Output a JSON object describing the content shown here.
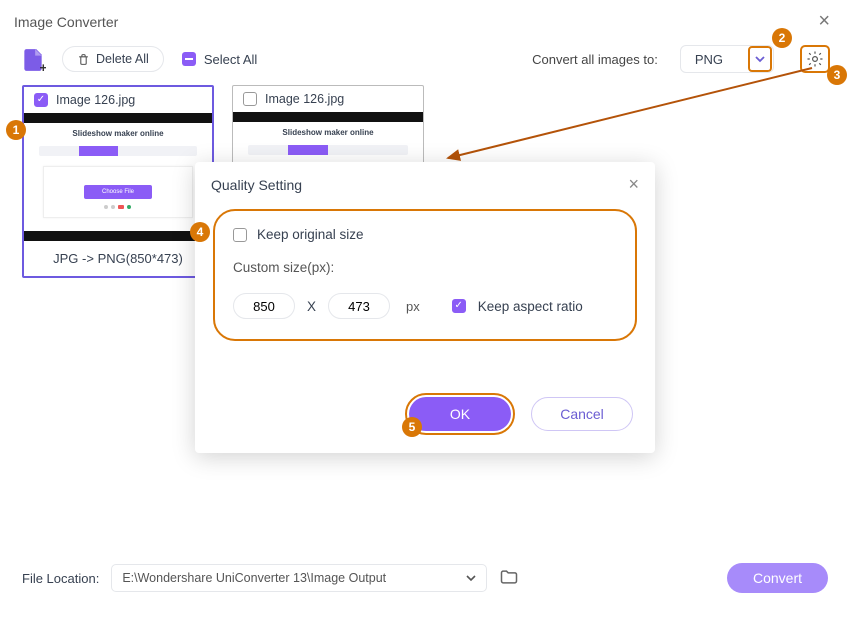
{
  "window": {
    "title": "Image Converter"
  },
  "toolbar": {
    "delete_all": "Delete All",
    "select_all": "Select All",
    "convert_label": "Convert all images to:",
    "format_selected": "PNG"
  },
  "images": [
    {
      "name": "Image 126.jpg",
      "checked": true,
      "footer": "JPG -> PNG(850*473)",
      "preview_title": "Slideshow maker online"
    },
    {
      "name": "Image 126.jpg",
      "checked": false,
      "footer": "",
      "preview_title": "Slideshow maker online"
    }
  ],
  "quality": {
    "title": "Quality Setting",
    "keep_original": {
      "label": "Keep original size",
      "checked": false
    },
    "custom_label": "Custom size(px):",
    "width": "850",
    "height": "473",
    "x_label": "X",
    "px_label": "px",
    "aspect": {
      "label": "Keep aspect ratio",
      "checked": true
    },
    "ok": "OK",
    "cancel": "Cancel"
  },
  "footer": {
    "file_location_label": "File Location:",
    "path": "E:\\Wondershare UniConverter 13\\Image Output",
    "convert": "Convert"
  },
  "badges": {
    "1": "1",
    "2": "2",
    "3": "3",
    "4": "4",
    "5": "5"
  }
}
